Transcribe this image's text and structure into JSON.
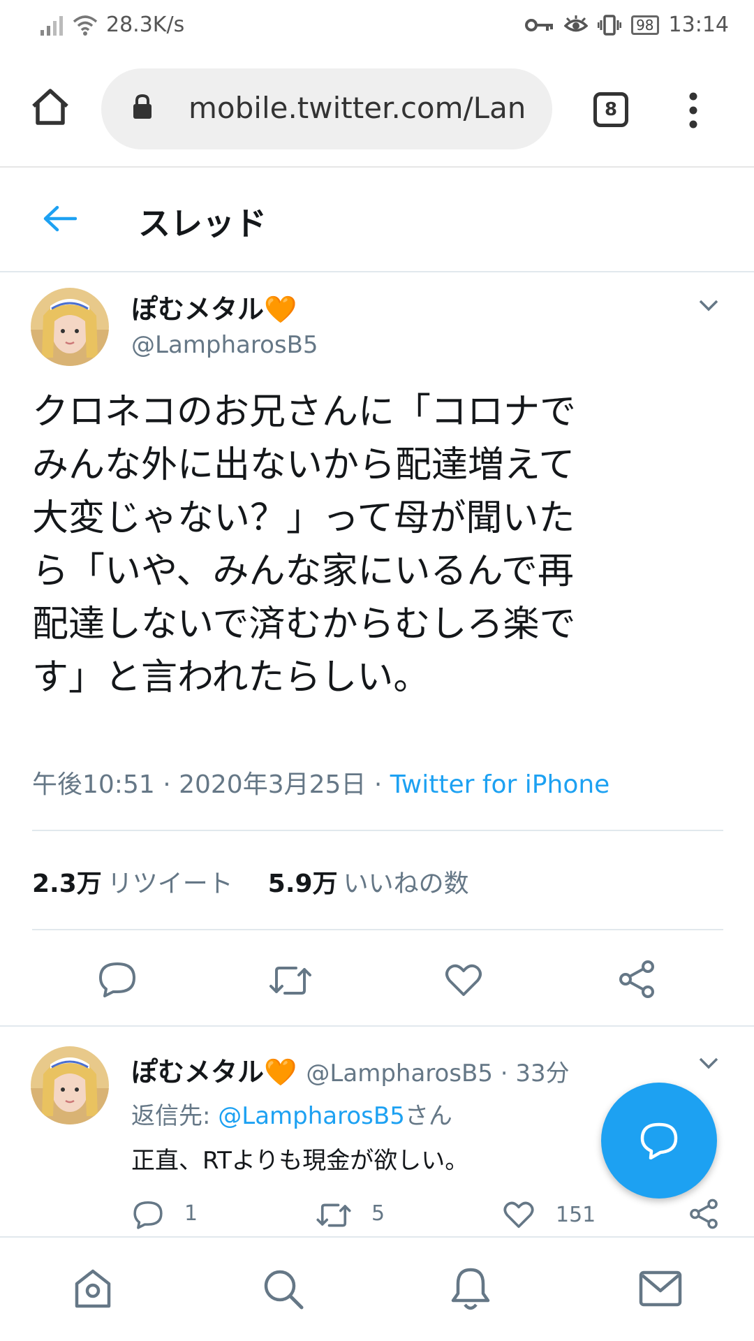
{
  "status_bar": {
    "network_speed": "28.3K/s",
    "battery": "98",
    "time": "13:14"
  },
  "browser": {
    "url": "mobile.twitter.com/Lan",
    "tab_count": "8"
  },
  "header": {
    "title": "スレッド"
  },
  "main_tweet": {
    "display_name": "ぽむメタル🧡",
    "handle": "@LampharosB5",
    "text": "クロネコのお兄さんに「コロナで\nみんな外に出ないから配達増えて\n大変じゃない？」って母が聞いた\nら「いや、みんな家にいるんで再\n配達しないで済むからむしろ楽で\nす」と言われたらしい。",
    "time": "午後10:51 · 2020年3月25日 · ",
    "source": "Twitter for iPhone",
    "retweets_count": "2.3万",
    "retweets_label": "リツイート",
    "likes_count": "5.9万",
    "likes_label": "いいねの数"
  },
  "reply_tweet": {
    "display_name": "ぽむメタル🧡",
    "handle_time": "@LampharosB5 · 33分",
    "reply_to_prefix": "返信先: ",
    "reply_to_handle": "@LampharosB5",
    "reply_to_suffix": "さん",
    "text": "正直、RTよりも現金が欲しい。",
    "reply_count": "1",
    "retweet_count": "5",
    "like_count": "151"
  },
  "colors": {
    "accent": "#1da1f2",
    "secondary_text": "#657786",
    "divider": "#e1e8ed"
  }
}
